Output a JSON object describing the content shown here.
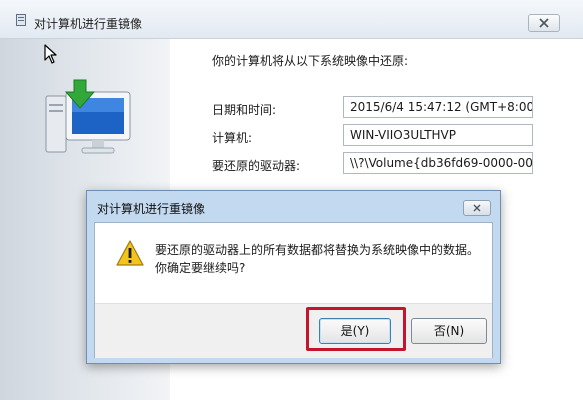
{
  "window": {
    "title": "对计算机进行重镜像",
    "intro": "你的计算机将从以下系统映像中还原:",
    "rows": [
      {
        "label": "日期和时间:",
        "value": "2015/6/4 15:47:12 (GMT+8:00)"
      },
      {
        "label": "计算机:",
        "value": "WIN-VIIO3ULTHVP"
      },
      {
        "label": "要还原的驱动器:",
        "value": "\\\\?\\Volume{db36fd69-0000-0000-"
      }
    ]
  },
  "dialog": {
    "title": "对计算机进行重镜像",
    "message_line1": "要还原的驱动器上的所有数据都将替换为系统映像中的数据。",
    "message_line2": "你确定要继续吗?",
    "yes_label": "是(Y)",
    "no_label": "否(N)"
  },
  "icons": {
    "window_icon": "system-restore-icon",
    "illustration": "computer-restore-icon",
    "warning": "warning-icon",
    "close": "close-icon"
  },
  "colors": {
    "highlight": "#c3152b",
    "dialog_frame": "#c2d9f0",
    "warning": "#f2c41c"
  }
}
